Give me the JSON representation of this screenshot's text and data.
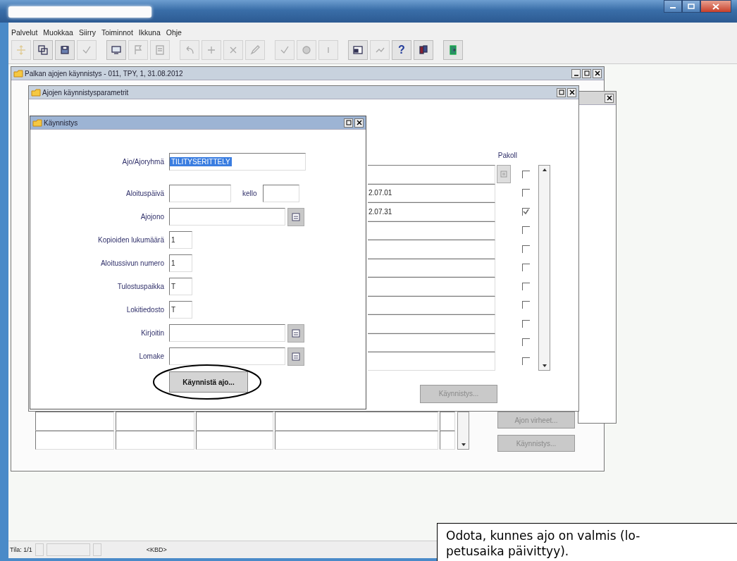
{
  "menu": [
    {
      "label": "Palvelut"
    },
    {
      "label": "Muokkaa"
    },
    {
      "label": "Siirry"
    },
    {
      "label": "Toiminnot"
    },
    {
      "label": "Ikkuna"
    },
    {
      "label": "Ohje"
    }
  ],
  "toolbar": [
    [
      {
        "kind": "arrows",
        "disabled": true
      },
      {
        "kind": "copy",
        "disabled": false
      },
      {
        "kind": "save",
        "disabled": false
      },
      {
        "kind": "check",
        "disabled": true
      }
    ],
    [
      {
        "kind": "print",
        "disabled": false
      },
      {
        "kind": "flag",
        "disabled": true
      },
      {
        "kind": "doc",
        "disabled": true
      }
    ],
    [
      {
        "kind": "undo",
        "disabled": true
      },
      {
        "kind": "add",
        "disabled": true
      },
      {
        "kind": "delete",
        "disabled": true
      },
      {
        "kind": "edit",
        "disabled": true
      }
    ],
    [
      {
        "kind": "tick",
        "disabled": true
      },
      {
        "kind": "circle",
        "disabled": true
      },
      {
        "kind": "bar",
        "disabled": true
      }
    ],
    [
      {
        "kind": "window",
        "disabled": false
      },
      {
        "kind": "sheet",
        "disabled": true
      },
      {
        "kind": "help",
        "glyph": "?",
        "disabled": false
      },
      {
        "kind": "books",
        "disabled": false
      }
    ],
    [
      {
        "kind": "exit",
        "disabled": false
      }
    ]
  ],
  "main_window": {
    "title": "Palkan ajojen käynnistys - 011, TPY, 1, 31.08.2012",
    "active": false,
    "buttons": [
      {
        "label": "Ajon virheet...",
        "disabled": true
      },
      {
        "label": "Käynnistys...",
        "disabled": true
      }
    ]
  },
  "params_window": {
    "title": "Ajojen käynnistysparametrit",
    "active": false,
    "required_header": "Pakoll",
    "rows": [
      {
        "kind": "lov",
        "checked": false
      },
      {
        "kind": "plain",
        "value": "2.07.01",
        "checked": false
      },
      {
        "kind": "plain",
        "value": "2.07.31",
        "checked": true
      },
      {
        "kind": "plain",
        "checked": false
      },
      {
        "kind": "plain",
        "checked": false
      },
      {
        "kind": "plain",
        "checked": false
      },
      {
        "kind": "plain",
        "checked": false
      },
      {
        "kind": "plain",
        "checked": false
      },
      {
        "kind": "plain",
        "checked": false
      },
      {
        "kind": "plain",
        "checked": false
      },
      {
        "kind": "plain",
        "checked": false
      }
    ],
    "button": {
      "label": "Käynnistys...",
      "disabled": true
    }
  },
  "start_window": {
    "title": "Käynnistys",
    "active": true,
    "fields": [
      {
        "label": "Ajo/Ajoryhmä",
        "kind": "wide",
        "value": "TILITYSERITTELY",
        "highlighted": true
      },
      {
        "label": "Aloituspäivä",
        "kind": "date",
        "extra_label": "kello"
      },
      {
        "label": "Ajojono",
        "kind": "lov"
      },
      {
        "label": "Kopioiden lukumäärä",
        "kind": "short",
        "value": "1",
        "highlighted": false
      },
      {
        "label": "Aloitussivun numero",
        "kind": "short",
        "value": "1",
        "highlighted": false
      },
      {
        "label": "Tulostuspaikka",
        "kind": "short",
        "value": "T",
        "highlighted": false
      },
      {
        "label": "Lokitiedosto",
        "kind": "short",
        "value": "T",
        "highlighted": false
      },
      {
        "label": "Kirjoitin",
        "kind": "lov"
      },
      {
        "label": "Lomake",
        "kind": "lov"
      }
    ],
    "button": {
      "label": "Käynnistä ajo...",
      "circled": true
    }
  },
  "status_bar": [
    "Tila: 1/1",
    "<KBD>"
  ],
  "callout": {
    "lines": [
      "Odota, kunnes ajo on valmis (lo-",
      "petusaika päivittyy)."
    ]
  }
}
